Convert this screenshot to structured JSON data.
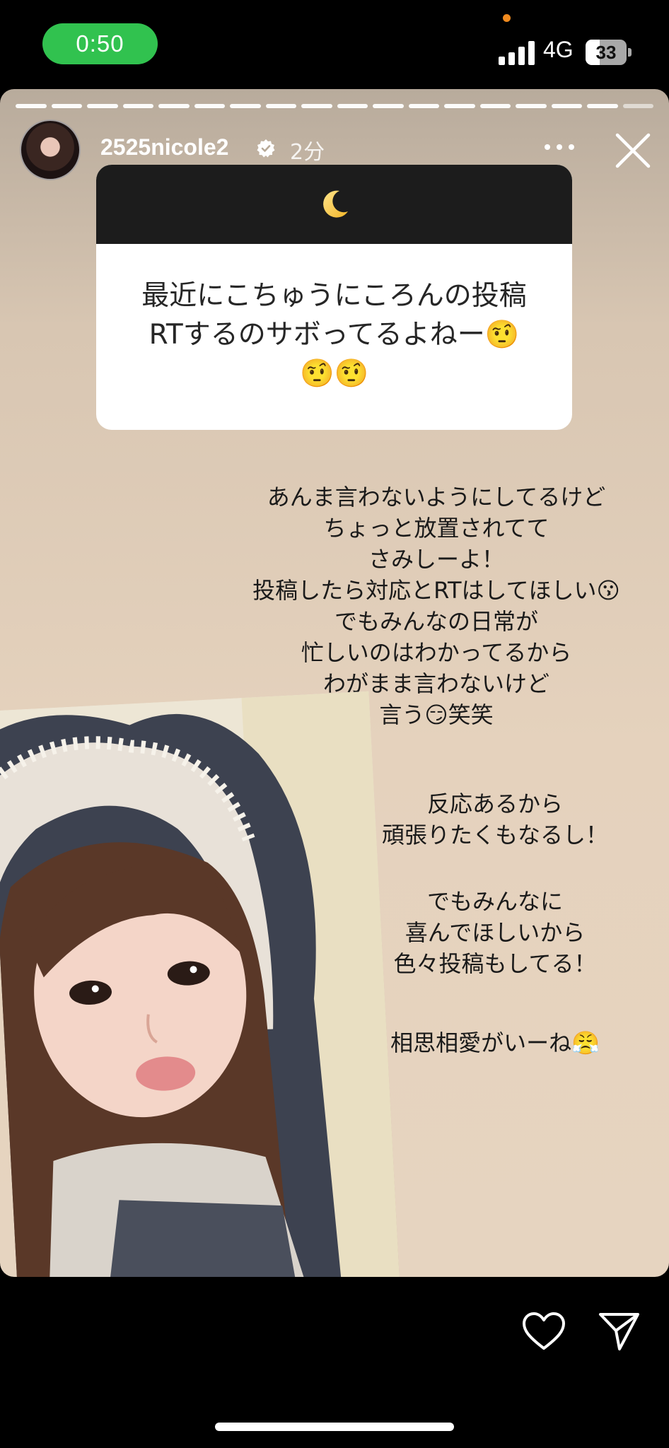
{
  "status_bar": {
    "time": "0:50",
    "network": "4G",
    "battery": "33"
  },
  "story": {
    "segments_total": 18,
    "segments_done": 17,
    "username": "2525nicole2",
    "verified_icon": "verified-badge-icon",
    "time_ago": "2分",
    "question_card": {
      "header_icon": "moon-icon",
      "question_lines": [
        "最近にこちゅうにころんの投稿",
        "RTするのサボってるよねー🤨",
        "🤨🤨"
      ]
    },
    "reply_main": "あんま言わないようにしてるけど\nちょっと放置されてて\nさみしーよ！\n投稿したら対応とRTはしてほしい😗\nでもみんなの日常が\n忙しいのはわかってるから\nわがまま言わないけど\n言う😏笑笑",
    "reply_second": "反応あるから\n頑張りたくもなるし！",
    "reply_third": "でもみんなに\n喜んでほしいから\n色々投稿もしてる！",
    "reply_fourth": "相思相愛がいーね😤"
  },
  "colors": {
    "accent_green": "#31c24f",
    "story_bg": "#e5d2bd"
  }
}
